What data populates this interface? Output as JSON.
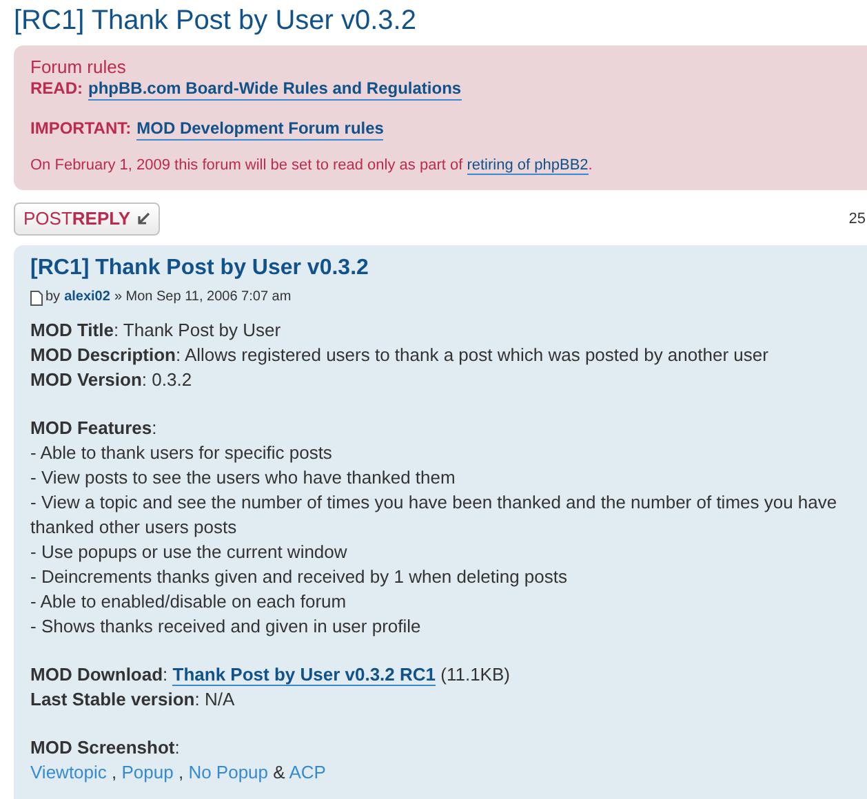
{
  "topic_title": "[RC1] Thank Post by User v0.3.2",
  "forum_rules": {
    "heading": "Forum rules",
    "lines": [
      [
        {
          "kind": "label",
          "text": "READ:"
        },
        {
          "kind": "link",
          "text": "phpBB.com Board-Wide Rules and Regulations"
        }
      ],
      [
        {
          "kind": "label",
          "text": "IMPORTANT:"
        },
        {
          "kind": "link",
          "text": "MOD Development Forum rules"
        }
      ]
    ],
    "notice": [
      {
        "kind": "text",
        "text": "On February 1, 2009 this forum will be set to read only as part of "
      },
      {
        "kind": "link",
        "text": "retiring of phpBB2"
      },
      {
        "kind": "text",
        "text": "."
      }
    ]
  },
  "post_reply": {
    "part_1": "POST",
    "part_2": "REPLY"
  },
  "pagination": "25",
  "post": {
    "title": "[RC1] Thank Post by User v0.3.2",
    "by": "by",
    "author": "alexi02",
    "date": "» Mon Sep 11, 2006 7:07 am",
    "paragraphs": [
      [
        [
          {
            "kind": "text",
            "text": "**MOD Title**: Thank Post by User"
          }
        ],
        [
          {
            "kind": "text",
            "text": "**MOD Description**: Allows registered users to thank a post which was posted by another user"
          }
        ],
        [
          {
            "kind": "text",
            "text": "**MOD Version**: 0.3.2"
          }
        ]
      ],
      [
        [
          {
            "kind": "text",
            "text": "**MOD Features**:"
          }
        ],
        [
          {
            "kind": "text",
            "text": "- Able to thank users for specific posts"
          }
        ],
        [
          {
            "kind": "text",
            "text": "- View posts to see the users who have thanked them"
          }
        ],
        [
          {
            "kind": "text",
            "text": "- View a topic and see the number of times you have been thanked and the number of times you have thanked other users posts"
          }
        ],
        [
          {
            "kind": "text",
            "text": "- Use popups or use the current window"
          }
        ],
        [
          {
            "kind": "text",
            "text": "- Deincrements thanks given and received by 1 when deleting posts"
          }
        ],
        [
          {
            "kind": "text",
            "text": "- Able to enabled/disable on each forum"
          }
        ],
        [
          {
            "kind": "text",
            "text": "- Shows thanks received and given in user profile"
          }
        ]
      ],
      [
        [
          {
            "kind": "text",
            "text": "**MOD Download**: "
          },
          {
            "kind": "link",
            "text": "Thank Post by User v0.3.2 RC1"
          },
          {
            "kind": "text",
            "text": " (11.1KB)"
          }
        ],
        [
          {
            "kind": "text",
            "text": "**Last Stable version**: N/A"
          }
        ]
      ],
      [
        [
          {
            "kind": "text",
            "text": "**MOD Screenshot**:"
          }
        ],
        [
          {
            "kind": "plainlink",
            "text": "Viewtopic"
          },
          {
            "kind": "text",
            "text": " , "
          },
          {
            "kind": "plainlink",
            "text": "Popup"
          },
          {
            "kind": "text",
            "text": " , "
          },
          {
            "kind": "plainlink",
            "text": "No Popup"
          },
          {
            "kind": "text",
            "text": " & "
          },
          {
            "kind": "plainlink",
            "text": "ACP"
          }
        ]
      ]
    ]
  }
}
